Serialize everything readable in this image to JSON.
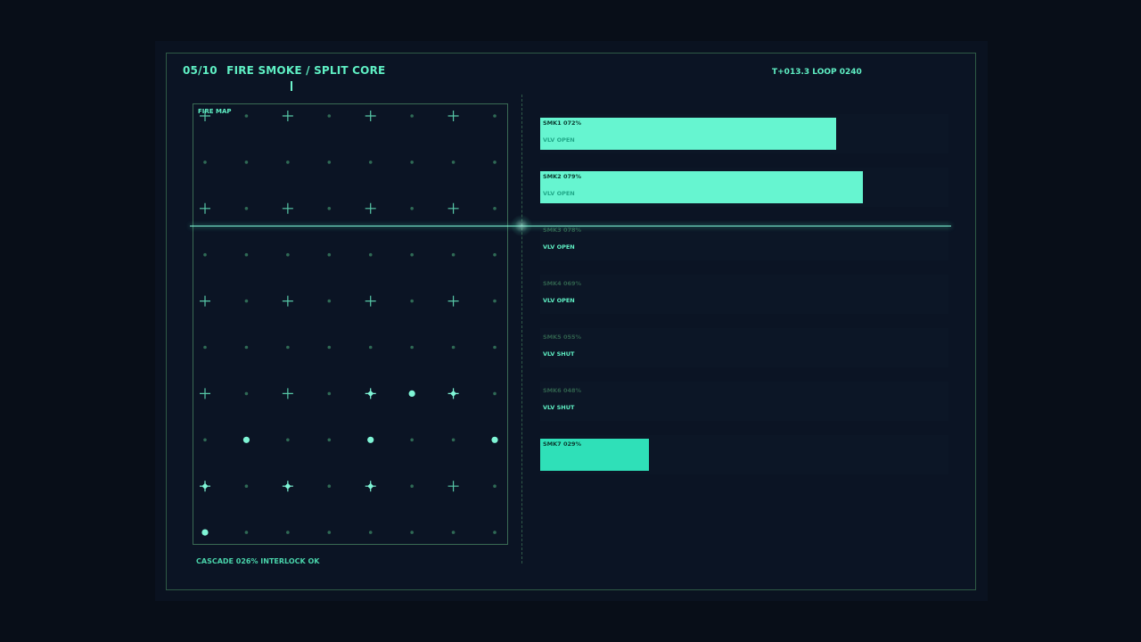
{
  "header": {
    "index": "05/10",
    "title": "FIRE SMOKE / SPLIT CORE",
    "timer": "T+013.3  LOOP 0240"
  },
  "map": {
    "label": "FIRE MAP",
    "cols": 8,
    "rows": 10,
    "cells": [
      [
        "plus",
        "dot",
        "plus",
        "dot",
        "plus",
        "dot",
        "plus",
        "dot"
      ],
      [
        "dot",
        "dot",
        "dot",
        "dot",
        "dot",
        "dot",
        "dot",
        "dot"
      ],
      [
        "plus",
        "dot",
        "plus",
        "dot",
        "plus",
        "dot",
        "plus",
        "dot"
      ],
      [
        "dot",
        "dot",
        "dot",
        "dot",
        "dot",
        "dot",
        "dot",
        "dot"
      ],
      [
        "plus",
        "dot",
        "plus",
        "dot",
        "plus",
        "dot",
        "plus",
        "dot"
      ],
      [
        "dot",
        "dot",
        "dot",
        "dot",
        "dot",
        "dot",
        "dot",
        "dot"
      ],
      [
        "plus",
        "dot",
        "plus",
        "dot",
        "star",
        "big",
        "star",
        "dot"
      ],
      [
        "dot",
        "big",
        "dot",
        "dot",
        "big",
        "dot",
        "dot",
        "big"
      ],
      [
        "star",
        "dot",
        "star",
        "dot",
        "star",
        "dot",
        "plus",
        "dot"
      ],
      [
        "big",
        "dot",
        "dot",
        "dot",
        "dot",
        "dot",
        "dot",
        "dot"
      ]
    ]
  },
  "channels": [
    {
      "name": "SMK1",
      "pct": "072%",
      "value": 72,
      "valve": "VLV OPEN",
      "active": true
    },
    {
      "name": "SMK2",
      "pct": "079%",
      "value": 79,
      "valve": "VLV OPEN",
      "active": true
    },
    {
      "name": "SMK3",
      "pct": "078%",
      "value": 78,
      "valve": "VLV OPEN",
      "active": false
    },
    {
      "name": "SMK4",
      "pct": "069%",
      "value": 69,
      "valve": "VLV OPEN",
      "active": false
    },
    {
      "name": "SMK5",
      "pct": "055%",
      "value": 55,
      "valve": "VLV SHUT",
      "active": false
    },
    {
      "name": "SMK6",
      "pct": "048%",
      "value": 48,
      "valve": "VLV SHUT",
      "active": false
    },
    {
      "name": "SMK7",
      "pct": "029%",
      "value": 29,
      "valve": "",
      "active": true
    }
  ],
  "footer": {
    "text": "CASCADE 026%  INTERLOCK OK"
  },
  "colors": {
    "accent": "#5ff0c4",
    "bar_bright": "#66f5d0",
    "bar_mid": "#2fe0b8",
    "dim_label": "#2f5f4c",
    "frame_border": "#2e5a45"
  }
}
